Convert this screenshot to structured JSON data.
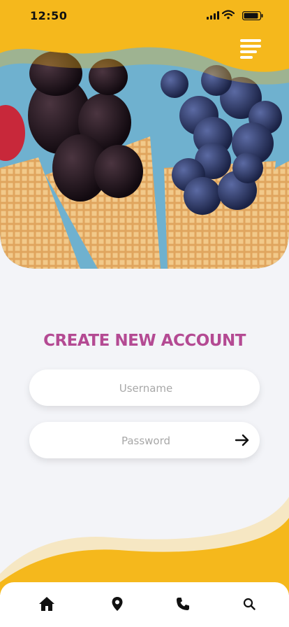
{
  "status_bar": {
    "time": "12:50"
  },
  "form": {
    "title": "CREATE NEW ACCOUNT",
    "username_placeholder": "Username",
    "password_placeholder": "Password"
  },
  "colors": {
    "brand_yellow": "#f5b81c",
    "title_pink": "#b44a93",
    "background": "#f3f4f8"
  },
  "icons": {
    "menu": "hamburger-icon",
    "submit": "arrow-right-icon",
    "nav": [
      "home-icon",
      "location-pin-icon",
      "phone-icon",
      "search-icon"
    ]
  }
}
